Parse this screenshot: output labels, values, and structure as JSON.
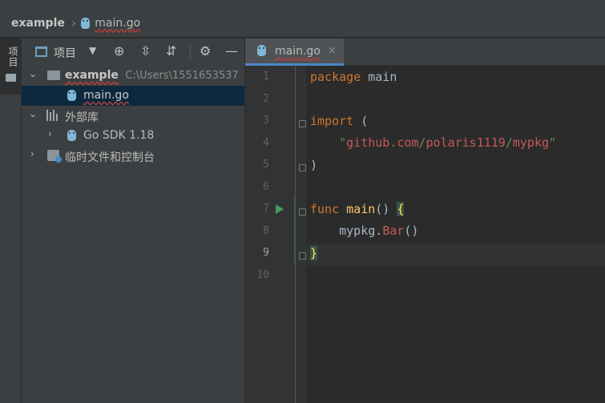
{
  "breadcrumb": {
    "project": "example",
    "file": "main.go"
  },
  "left_strip": {
    "tab_label": "项目"
  },
  "project_panel": {
    "title": "项目",
    "tree": [
      {
        "label": "example",
        "path": "C:\\Users\\1551653537"
      },
      {
        "label": "main.go"
      },
      {
        "label": "外部库"
      },
      {
        "label": "Go SDK 1.18"
      },
      {
        "label": "临时文件和控制台"
      }
    ]
  },
  "editor": {
    "tab_label": "main.go",
    "current_line": 9,
    "line_numbers": [
      "1",
      "2",
      "3",
      "4",
      "5",
      "6",
      "7",
      "8",
      "9",
      "10"
    ],
    "code": {
      "l1_kw": "package",
      "l1_name": " main",
      "l3_kw": "import",
      "l3_rest": " (",
      "l4_indent": "    ",
      "l4_q1": "\"",
      "l4_p1": "github.com",
      "l4_s1": "/",
      "l4_p2": "polaris1119",
      "l4_s2": "/",
      "l4_p3": "mypkg",
      "l4_q2": "\"",
      "l5": ")",
      "l7_kw": "func",
      "l7_fn": " main",
      "l7_paren": "() ",
      "l7_brace": "{",
      "l8_indent": "    ",
      "l8_pkg": "mypkg",
      "l8_dot": ".",
      "l8_call": "Bar",
      "l8_paren": "()",
      "l9": "}"
    }
  },
  "colors": {
    "keyword": "#cc7832",
    "function": "#ffc66d",
    "string": "#6a8759",
    "selection": "#0d293e",
    "tab_underline": "#4a88c7"
  }
}
